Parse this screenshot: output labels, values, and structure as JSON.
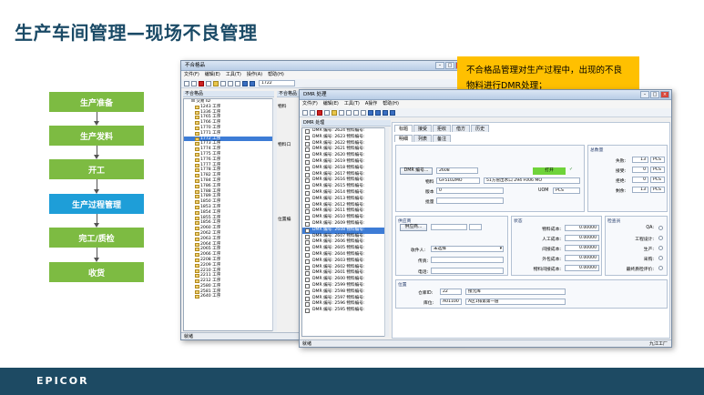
{
  "slide": {
    "title": "生产车间管理—现场不良管理",
    "logo": "EPICOR",
    "callout": "不合格品管理对生产过程中，出现的不良物料进行DMR处理；",
    "colors": {
      "title": "#1a4a66",
      "bar": "#1d4a63",
      "green": "#7dbb42",
      "blue": "#1e9ed8",
      "callout": "#ffc000"
    }
  },
  "flow": {
    "steps": [
      {
        "label": "生产准备",
        "highlight": false
      },
      {
        "label": "生产发料",
        "highlight": false
      },
      {
        "label": "开工",
        "highlight": false
      },
      {
        "label": "生产过程管理",
        "highlight": true
      },
      {
        "label": "完工/质检",
        "highlight": false
      },
      {
        "label": "收货",
        "highlight": false
      }
    ]
  },
  "win1": {
    "title": "不合格品",
    "menu": [
      "文件(F)",
      "编辑(E)",
      "工具(T)",
      "操作(A)",
      "帮助(H)"
    ],
    "toolbar_search": "1722",
    "panel_header": "不合格品",
    "panel_header2": "不合格品",
    "tree_root": "交易 ID",
    "tree_items": [
      "1243 工序",
      "1336 工序",
      "1765 工序",
      "1766 工序",
      "1770 工序",
      "1771 工序",
      "1772 工序",
      "1773 工序",
      "1774 工序",
      "1775 工序",
      "1776 工序",
      "1777 工序",
      "1778 工序",
      "1782 工序",
      "1784 工序",
      "1786 工序",
      "1788 工序",
      "1789 工序",
      "1850 工序",
      "1853 工序",
      "1854 工序",
      "1855 工序",
      "1856 工序",
      "2060 工序",
      "2062 工序",
      "2063 工序",
      "2064 工序",
      "2065 工序",
      "2066 工序",
      "2208 工序",
      "2209 工序",
      "2210 工序",
      "2211 工序",
      "2212 工序",
      "2580 工序",
      "2581 工序",
      "2640 工序"
    ],
    "tree_selected": 6,
    "labels": [
      "物料",
      "物料口",
      "位置编",
      "ID",
      "部门"
    ],
    "status": "就绪"
  },
  "win2": {
    "title": "DMR 处理",
    "menu": [
      "文件(F)",
      "编辑(E)",
      "工具(T)",
      "A操作",
      "帮助(H)"
    ],
    "panel_header": "DMR 处理",
    "tab_row1": [
      "标题",
      "接受",
      "拒收",
      "借方",
      "历史"
    ],
    "tab_row2": [
      "明细",
      "列表",
      "备注"
    ],
    "list_items": [
      "DMR 编号: 2624 物料编号:",
      "DMR 编号: 2623 物料编号:",
      "DMR 编号: 2622 物料编号:",
      "DMR 编号: 2621 物料编号:",
      "DMR 编号: 2620 物料编号:",
      "DMR 编号: 2619 物料编号:",
      "DMR 编号: 2618 物料编号:",
      "DMR 编号: 2617 物料编号:",
      "DMR 编号: 2616 物料编号:",
      "DMR 编号: 2615 物料编号:",
      "DMR 编号: 2614 物料编号:",
      "DMR 编号: 2613 物料编号:",
      "DMR 编号: 2612 物料编号:",
      "DMR 编号: 2611 物料编号:",
      "DMR 编号: 2610 物料编号:",
      "DMR 编号: 2609 物料编号:",
      "DMR 编号: 2608 物料编号:",
      "DMR 编号: 2607 物料编号:",
      "DMR 编号: 2606 物料编号:",
      "DMR 编号: 2605 物料编号:",
      "DMR 编号: 2604 物料编号:",
      "DMR 编号: 2603 物料编号:",
      "DMR 编号: 2602 物料编号:",
      "DMR 编号: 2601 物料编号:",
      "DMR 编号: 2600 物料编号:",
      "DMR 编号: 2599 物料编号:",
      "DMR 编号: 2598 物料编号:",
      "DMR 编号: 2597 物料编号:",
      "DMR 编号: 2596 物料编号:",
      "DMR 编号: 2595 物料编号:"
    ],
    "list_selected": 16,
    "detail": {
      "dmr_button": "DMR 编号...",
      "dmr_number": "2608",
      "open_badge": "打开",
      "part_label": "物料",
      "part_number": "GF5102MO",
      "part_desc": "51方管出水口 294 F006 MO",
      "rev_label": "版本",
      "rev_value": "0",
      "uom_label": "UOM",
      "uom_value": "PCS",
      "batch_label": "批量",
      "total_header": "总数量",
      "totals": [
        {
          "label": "失败:",
          "value": "13",
          "uom": "PCS"
        },
        {
          "label": "接受:",
          "value": "0",
          "uom": "PCS"
        },
        {
          "label": "拒绝:",
          "value": "0",
          "uom": "PCS"
        },
        {
          "label": "剩余:",
          "value": "13",
          "uom": "PCS"
        }
      ],
      "supplier_header": "供应商",
      "supplier_button": "供应商...",
      "receiver_label": "收件人:",
      "receiver_value": "未选择",
      "fax_label": "传真:",
      "phone_label": "电话:",
      "status_header": "状态",
      "costs": [
        {
          "label": "物料成本:",
          "value": "0.00000"
        },
        {
          "label": "人工成本:",
          "value": "0.00000"
        },
        {
          "label": "间接成本:",
          "value": "0.00000"
        },
        {
          "label": "外包成本:",
          "value": "0.00000"
        },
        {
          "label": "物料间接成本:",
          "value": "0.00000"
        }
      ],
      "inspect_header": "检查员",
      "inspect": [
        "QA:",
        "工程设计:",
        "生产:",
        "采购:",
        "最终质检评价:"
      ],
      "location_header": "位置",
      "warehouse_label": "仓库ID:",
      "warehouse_code": "22",
      "warehouse_name": "接元库",
      "bin_label": "库位:",
      "bin_code": "A01100",
      "bin_name": "A区1排第第一层"
    },
    "status_left": "就绪",
    "status_right": "九江工厂"
  }
}
